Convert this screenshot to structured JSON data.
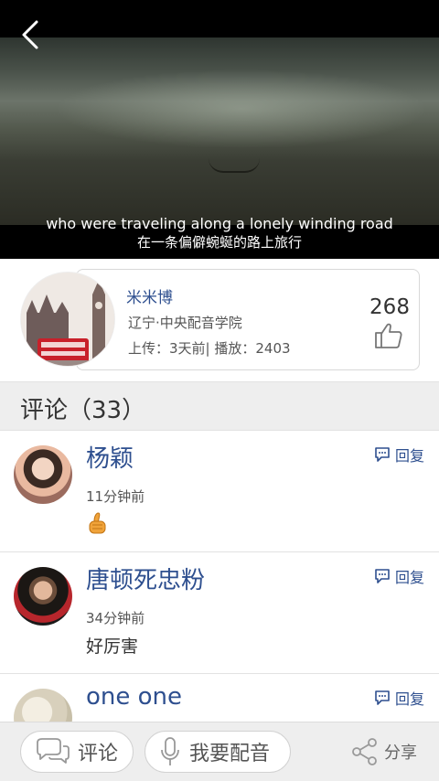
{
  "video": {
    "subtitle_en": "who were traveling along a lonely winding road",
    "subtitle_zh": "在一条偏僻蜿蜒的路上旅行"
  },
  "uploader": {
    "name": "米米博",
    "school": "辽宁·中央配音学院",
    "stats": "上传：3天前| 播放：2403",
    "likes": "268"
  },
  "comments_header": {
    "title": "评论（33）"
  },
  "comments": [
    {
      "name": "杨颖",
      "time": "11分钟前",
      "text": "",
      "reply_label": "回复",
      "thumbs_emoji": true
    },
    {
      "name": "唐顿死忠粉",
      "time": "34分钟前",
      "text": "好厉害",
      "reply_label": "回复"
    },
    {
      "name": "one one",
      "time": "",
      "text": "",
      "reply_label": "回复"
    }
  ],
  "bottom_bar": {
    "comment_label": "评论",
    "dub_label": "我要配音",
    "share_label": "分享"
  },
  "colors": {
    "accent": "#2e4f8f",
    "bar_bg": "#eeeeee"
  }
}
